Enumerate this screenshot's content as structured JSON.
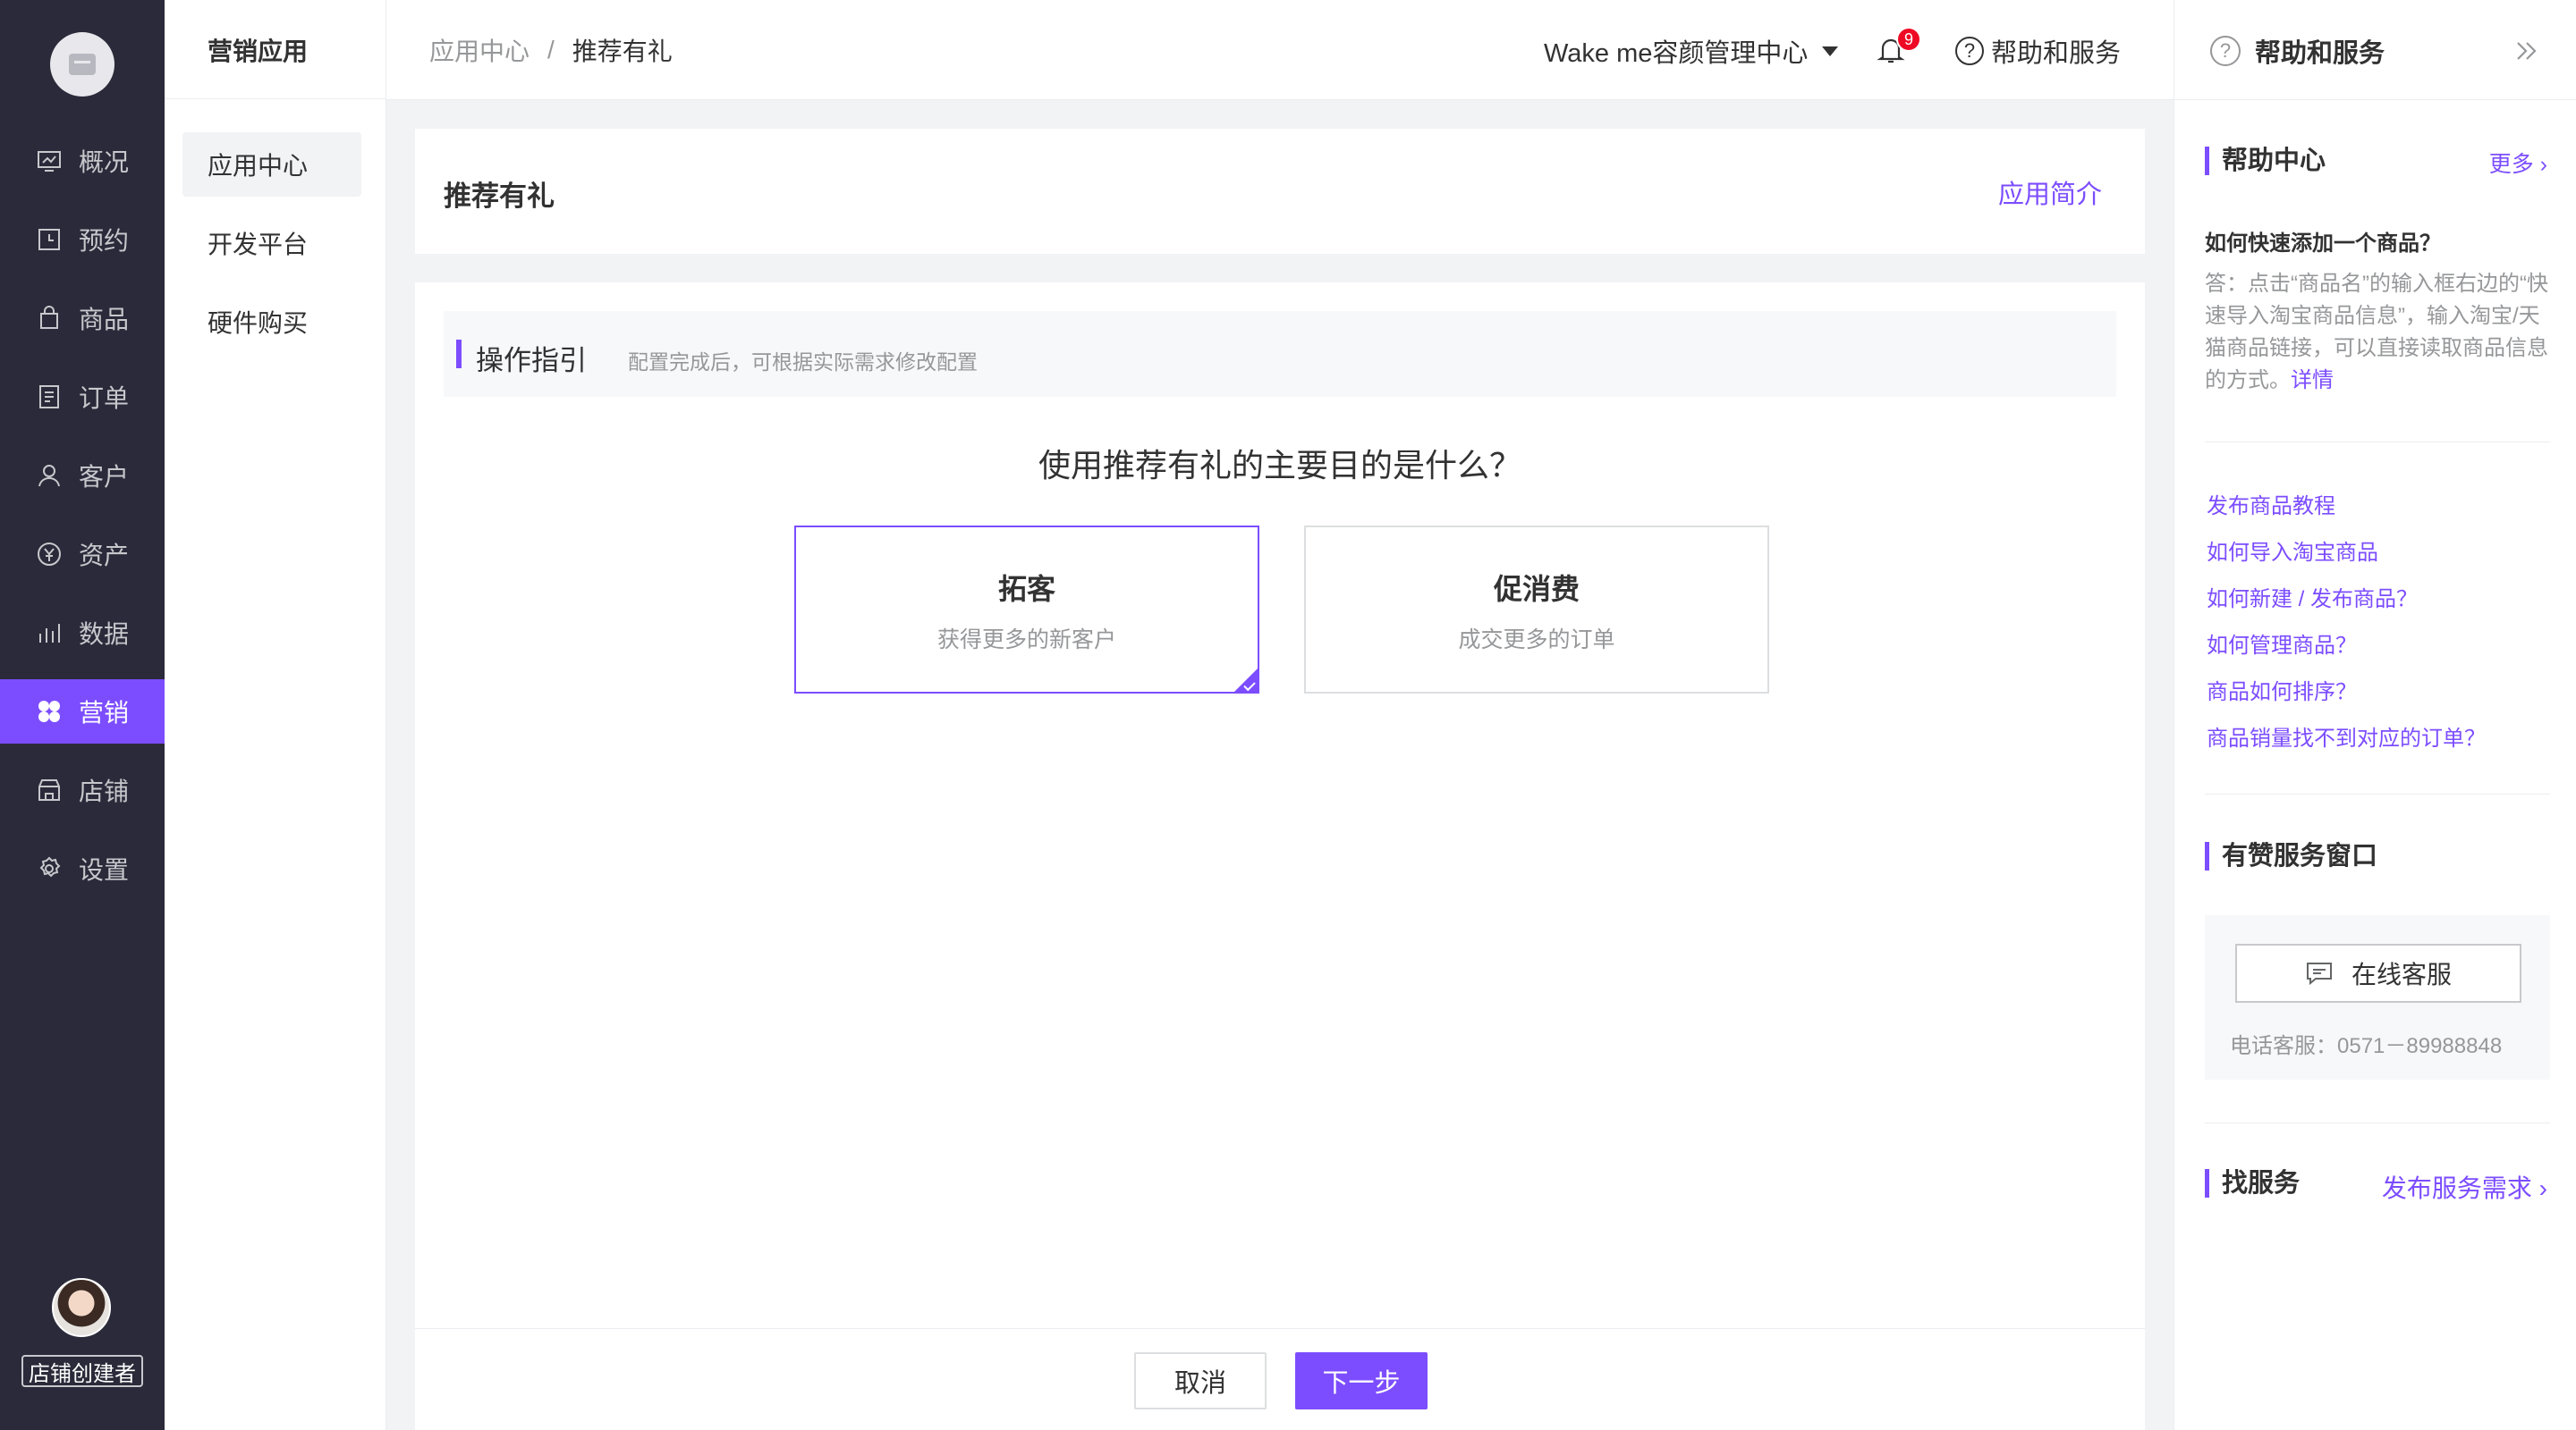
{
  "nav": {
    "items": [
      {
        "label": "概况",
        "icon": "dashboard-icon"
      },
      {
        "label": "预约",
        "icon": "calendar-icon"
      },
      {
        "label": "商品",
        "icon": "bag-icon"
      },
      {
        "label": "订单",
        "icon": "order-icon"
      },
      {
        "label": "客户",
        "icon": "user-icon"
      },
      {
        "label": "资产",
        "icon": "yen-icon"
      },
      {
        "label": "数据",
        "icon": "chart-icon"
      },
      {
        "label": "营销",
        "icon": "marketing-icon"
      },
      {
        "label": "店铺",
        "icon": "store-icon"
      },
      {
        "label": "设置",
        "icon": "gear-icon"
      }
    ],
    "active_index": 7,
    "role_badge": "店铺创建者"
  },
  "subnav": {
    "title": "营销应用",
    "items": [
      {
        "label": "应用中心"
      },
      {
        "label": "开发平台"
      },
      {
        "label": "硬件购买"
      }
    ],
    "active_index": 0
  },
  "header": {
    "breadcrumb": [
      "应用中心",
      "/",
      "推荐有礼"
    ],
    "store_name": "Wake me容颜管理中心",
    "notification_count": "9",
    "help_label": "帮助和服务"
  },
  "page": {
    "title": "推荐有礼",
    "intro_link": "应用简介",
    "guide_title": "操作指引",
    "guide_subtitle": "配置完成后，可根据实际需求修改配置",
    "question": "使用推荐有礼的主要目的是什么？",
    "options": [
      {
        "title": "拓客",
        "desc": "获得更多的新客户",
        "selected": true
      },
      {
        "title": "促消费",
        "desc": "成交更多的订单",
        "selected": false
      }
    ],
    "cancel_label": "取消",
    "next_label": "下一步"
  },
  "help_panel": {
    "title": "帮助和服务",
    "help_center": {
      "title": "帮助中心",
      "more": "更多 ›",
      "faq_question": "如何快速添加一个商品？",
      "faq_answer": "答：点击“商品名”的输入框右边的“快速导入淘宝商品信息”，输入淘宝/天猫商品链接，可以直接读取商品信息的方式。",
      "faq_detail": "详情",
      "links": [
        "发布商品教程",
        "如何导入淘宝商品",
        "如何新建 / 发布商品？",
        "如何管理商品？",
        "商品如何排序？",
        "商品销量找不到对应的订单？"
      ]
    },
    "service_window": {
      "title": "有赞服务窗口",
      "online_button": "在线客服",
      "phone": "电话客服：0571－89988848"
    },
    "find_service": {
      "title": "找服务",
      "link": "发布服务需求 ›"
    }
  },
  "colors": {
    "accent": "#7c4dff",
    "sidebar_bg": "#2a2a3a",
    "badge": "#ee0a24"
  }
}
